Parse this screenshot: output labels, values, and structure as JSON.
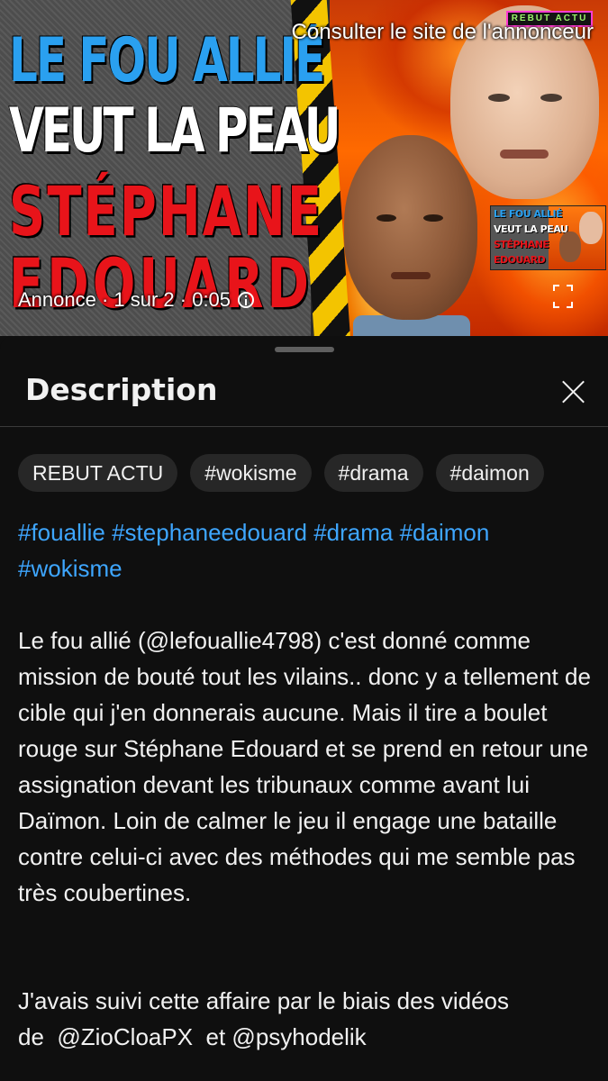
{
  "ad": {
    "thumbnail_lines": [
      "LE FOU ALLIÉ",
      "VEUT LA PEAU",
      "STÉPHANE",
      "EDOUARD"
    ],
    "channel_badge": "REBUT ACTU",
    "advertiser_link": "Consulter le site de l'annonceur",
    "meta": "Annonce · 1 sur 2 · 0:05",
    "mini_thumbnail_lines": [
      "LE FOU ALLIÉ",
      "VEUT LA PEAU",
      "STÉPHANE",
      "EDOUARD"
    ]
  },
  "panel": {
    "title": "Description",
    "chips": [
      "REBUT ACTU",
      "#wokisme",
      "#drama",
      "#daimon"
    ],
    "hashtags": [
      "#fouallie",
      "#stephaneedouard",
      "#drama",
      "#daimon",
      "#wokisme"
    ],
    "paragraph1": "Le fou allié (@lefouallie4798) c'est donné comme mission de bouté tout les vilains.. donc y a tellement de cible qui j'en donnerais aucune. Mais il tire a boulet rouge sur Stéphane Edouard et se prend en retour une assignation devant les tribunaux comme avant lui Daïmon. Loin de calmer le jeu il engage une bataille contre celui-ci avec des méthodes qui me semble pas très coubertines.",
    "paragraph2_prefix": "J'avais suivi cette affaire par le biais des vidéos de",
    "mention1": "@ZioCloaPX",
    "paragraph2_mid": "et",
    "mention2": "@psyhodelik"
  },
  "colors": {
    "background": "#0f0f0f",
    "chip": "#272727",
    "hashtag": "#3ea6ff",
    "title_blue": "#2aa0f0",
    "title_red": "#e8141a"
  }
}
